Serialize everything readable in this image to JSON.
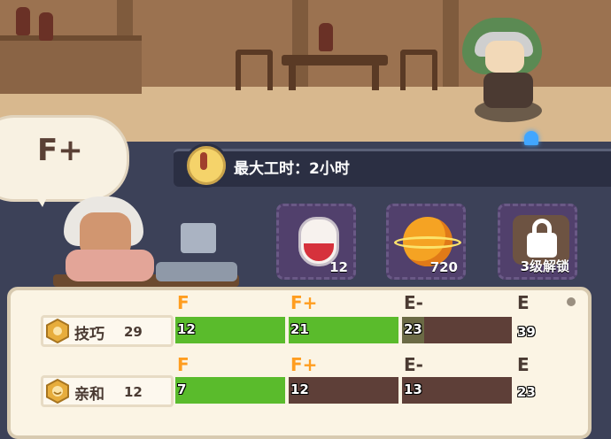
{
  "speech_bubble": {
    "grade": "F+"
  },
  "workstation": {
    "max_work_time": "最大工时：2小时"
  },
  "item_slots": [
    {
      "icon": "red-potion-icon",
      "count": "12"
    },
    {
      "icon": "golden-planet-icon",
      "count": "720"
    },
    {
      "icon": "lock-icon",
      "count": "3级解锁"
    }
  ],
  "attributes": [
    {
      "icon": "skill-fist-icon",
      "name": "技巧",
      "value": "29",
      "tiers": [
        {
          "label": "F",
          "color": "#ff9d1f",
          "start": "12",
          "fill": 1.0
        },
        {
          "label": "F+",
          "color": "#ff9d1f",
          "start": "21",
          "fill": 1.0
        },
        {
          "label": "E-",
          "color": "#4a3a32",
          "start": "23",
          "fill": 0.2
        },
        {
          "label": "E",
          "color": "#4a3a32",
          "start": "39",
          "fill": 0
        }
      ]
    },
    {
      "icon": "affinity-smile-icon",
      "name": "亲和",
      "value": "12",
      "tiers": [
        {
          "label": "F",
          "color": "#ff9d1f",
          "start": "7",
          "fill": 1.0
        },
        {
          "label": "F+",
          "color": "#ff9d1f",
          "start": "12",
          "fill": 0
        },
        {
          "label": "E-",
          "color": "#4a3a32",
          "start": "13",
          "fill": 0
        },
        {
          "label": "E",
          "color": "#4a3a32",
          "start": "23",
          "fill": 0
        }
      ]
    }
  ],
  "colors": {
    "bar_fill": "#5abb2c",
    "bar_empty": "#5e3f38",
    "accent_orange": "#ff9d1f"
  }
}
